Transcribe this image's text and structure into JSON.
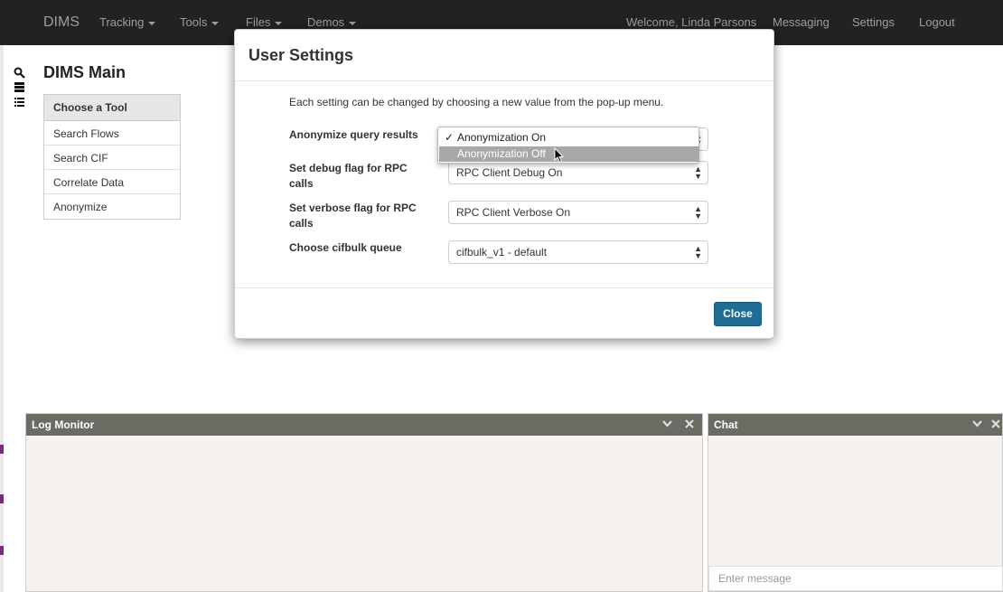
{
  "navbar": {
    "brand": "DIMS",
    "menus": [
      "Tracking",
      "Tools",
      "Files",
      "Demos"
    ],
    "welcome": "Welcome, Linda Parsons",
    "links": [
      "Messaging",
      "Settings",
      "Logout"
    ]
  },
  "page": {
    "title": "DIMS Main"
  },
  "tools": {
    "header": "Choose a Tool",
    "items": [
      "Search Flows",
      "Search CIF",
      "Correlate Data",
      "Anonymize"
    ]
  },
  "panels": {
    "log_title": "Log Monitor",
    "chat_title": "Chat",
    "chat_placeholder": "Enter message"
  },
  "modal": {
    "title": "User Settings",
    "intro": "Each setting can be changed by choosing a new value from the pop-up menu.",
    "settings": [
      {
        "label": "Anonymize query results",
        "value": ""
      },
      {
        "label": "Set debug flag for RPC calls",
        "value": "RPC Client Debug On"
      },
      {
        "label": "Set verbose flag for RPC calls",
        "value": "RPC Client Verbose On"
      },
      {
        "label": "Choose cifbulk queue",
        "value": "cifbulk_v1 - default"
      }
    ],
    "close_label": "Close"
  },
  "popup": {
    "options": [
      "Anonymization On",
      "Anonymization Off"
    ],
    "selected": "Anonymization On",
    "hovered": "Anonymization Off"
  },
  "colors": {
    "navbar_bg": "#222222",
    "panel_header": "#6b6b63",
    "primary_button": "#1f6c95",
    "left_marker": "#7a2a7a"
  }
}
